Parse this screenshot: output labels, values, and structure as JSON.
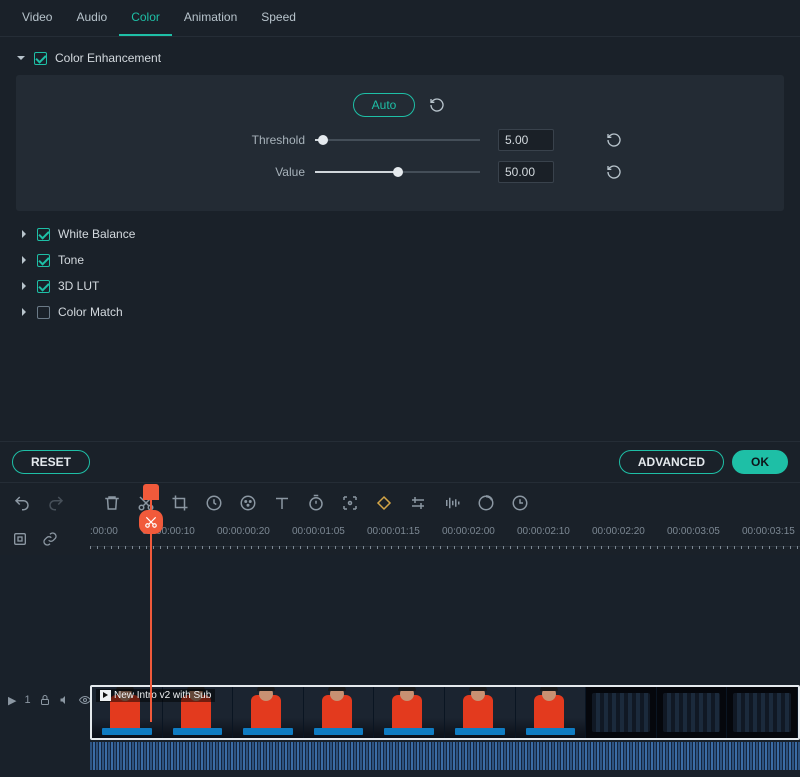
{
  "tabs": {
    "video": "Video",
    "audio": "Audio",
    "color": "Color",
    "animation": "Animation",
    "speed": "Speed"
  },
  "colorEnhancement": {
    "label": "Color Enhancement",
    "autoButton": "Auto",
    "threshold": {
      "label": "Threshold",
      "value": "5.00",
      "percent": 5
    },
    "value": {
      "label": "Value",
      "value": "50.00",
      "percent": 50
    }
  },
  "sections": {
    "whiteBalance": "White Balance",
    "tone": "Tone",
    "lut": "3D LUT",
    "colorMatch": "Color Match"
  },
  "buttons": {
    "reset": "RESET",
    "advanced": "ADVANCED",
    "ok": "OK"
  },
  "timeline": {
    "clipTitle": "New Intro v2 with Sub",
    "trackLabel": "1",
    "timeLabels": [
      {
        "t": ":00:00",
        "pos": 0
      },
      {
        "t": "00:00:00:10",
        "pos": 52
      },
      {
        "t": "00:00:00:20",
        "pos": 127
      },
      {
        "t": "00:00:01:05",
        "pos": 202
      },
      {
        "t": "00:00:01:15",
        "pos": 277
      },
      {
        "t": "00:00:02:00",
        "pos": 352
      },
      {
        "t": "00:00:02:10",
        "pos": 427
      },
      {
        "t": "00:00:02:20",
        "pos": 502
      },
      {
        "t": "00:00:03:05",
        "pos": 577
      },
      {
        "t": "00:00:03:15",
        "pos": 652
      }
    ]
  }
}
